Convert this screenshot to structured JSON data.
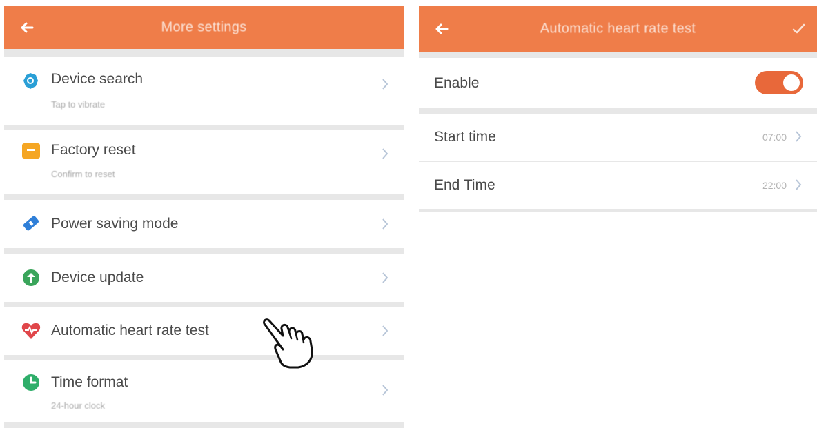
{
  "left": {
    "header": {
      "title": "More settings"
    },
    "items": [
      {
        "label": "Device search",
        "sublabel": "Tap to vibrate",
        "icon": "device-search-icon",
        "icon_color": "#2a9fd6"
      },
      {
        "label": "Factory reset",
        "sublabel": "Confirm to reset",
        "icon": "factory-reset-icon",
        "icon_color": "#f5a623"
      },
      {
        "label": "Power saving mode",
        "sublabel": "",
        "icon": "power-saving-icon",
        "icon_color": "#2f7fd8"
      },
      {
        "label": "Device update",
        "sublabel": "",
        "icon": "device-update-icon",
        "icon_color": "#3aa55b"
      },
      {
        "label": "Automatic heart rate test",
        "sublabel": "",
        "icon": "heart-rate-icon",
        "icon_color": "#e0464a"
      },
      {
        "label": "Time format",
        "sublabel": "24-hour clock",
        "icon": "time-format-icon",
        "icon_color": "#2fae6a"
      }
    ]
  },
  "right": {
    "header": {
      "title": "Automatic heart rate test"
    },
    "enable": {
      "label": "Enable",
      "on": true
    },
    "start_time": {
      "label": "Start time",
      "value": "07:00"
    },
    "end_time": {
      "label": "End Time",
      "value": "22:00"
    }
  },
  "colors": {
    "accent": "#ef7d49",
    "toggle_on": "#e8683a"
  },
  "overlay": {
    "icon": "pointing-hand-icon"
  }
}
